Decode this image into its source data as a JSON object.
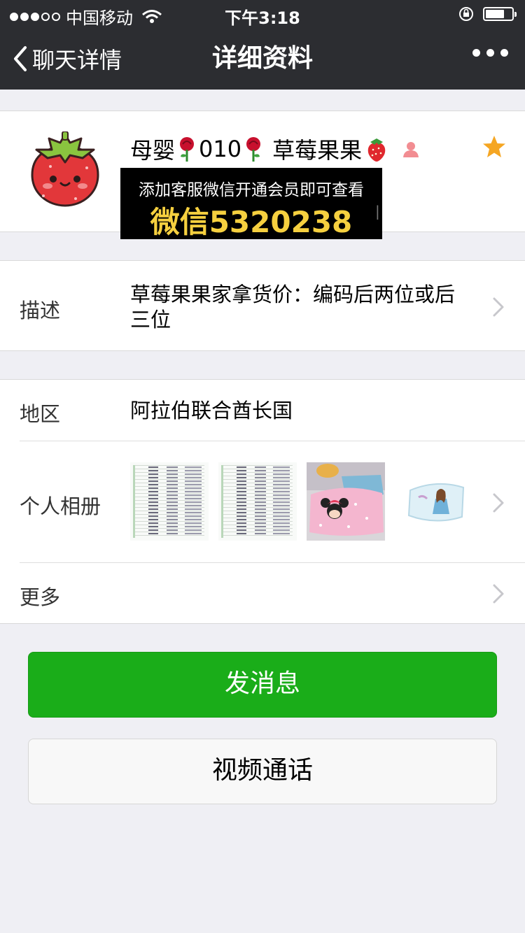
{
  "status_bar": {
    "carrier": "中国移动",
    "time": "下午3:18",
    "signal_dots_filled": 3,
    "signal_dots_total": 5
  },
  "nav": {
    "back_label": "聊天详情",
    "title": "详细资料"
  },
  "profile": {
    "name_part1": "母婴",
    "name_part2": "010",
    "name_part3": "草莓果果",
    "starred": true
  },
  "ad_overlay": {
    "line1": "添加客服微信开通会员即可查看",
    "line2": "微信5320238"
  },
  "description": {
    "label": "描述",
    "value_line1": "草莓果果家拿货价：编码后两位或后",
    "value_line2": "三位"
  },
  "region": {
    "label": "地区",
    "value": "阿拉伯联合酋长国"
  },
  "album": {
    "label": "个人相册"
  },
  "more": {
    "label": "更多"
  },
  "buttons": {
    "send_message": "发消息",
    "video_call": "视频通话"
  },
  "colors": {
    "nav_bg": "#2c2d31",
    "primary_green": "#1aad19",
    "page_bg": "#efeff4",
    "star": "#f5a623"
  }
}
